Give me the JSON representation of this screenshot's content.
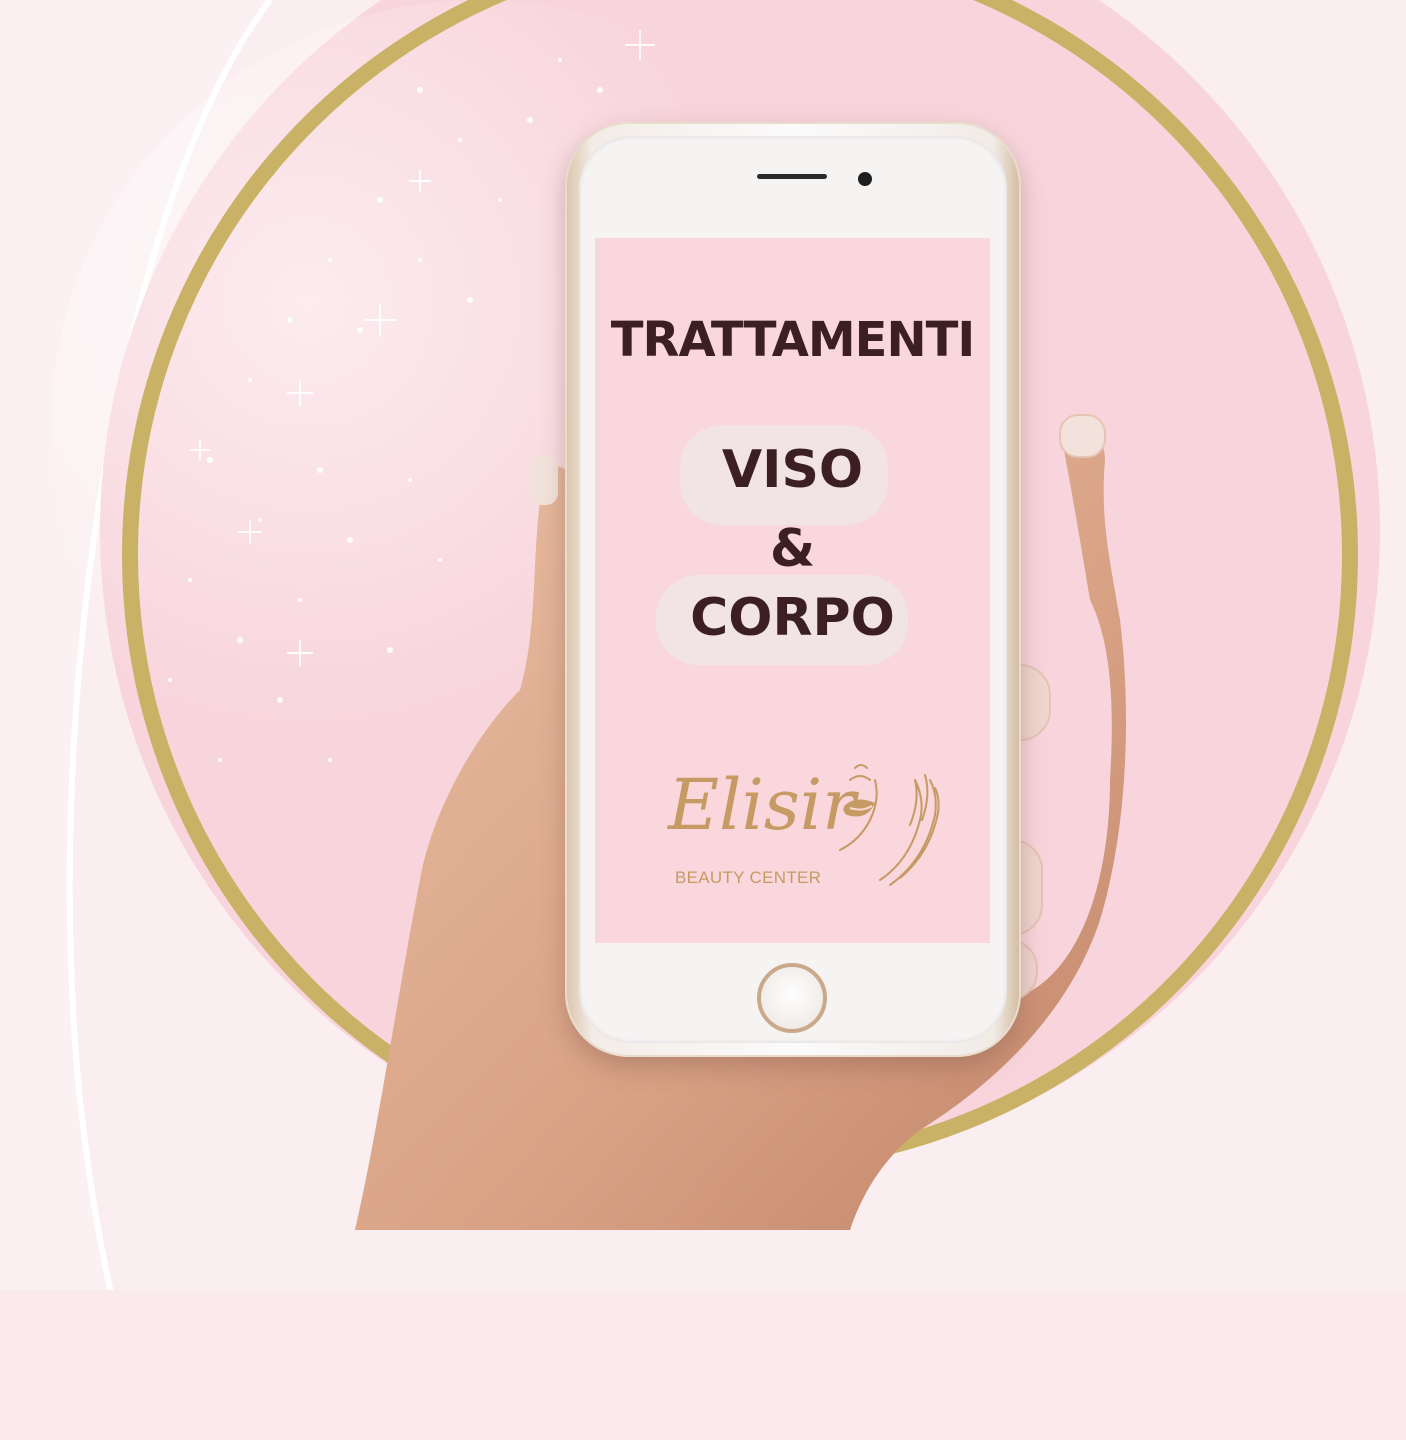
{
  "screen": {
    "title": "TRATTAMENTI",
    "line1": "VISO",
    "line2": "&",
    "line3": "CORPO"
  },
  "logo": {
    "name": "Elisir",
    "tagline": "BEAUTY CENTER",
    "icon": "face-hands-logo-icon"
  },
  "colors": {
    "background": "#fbeef0",
    "circle": "#f8d5dc",
    "gold_ring": "#c9b266",
    "screen": "#fad6dd",
    "text": "#3b1f23",
    "logo_gold": "#c59a63"
  }
}
